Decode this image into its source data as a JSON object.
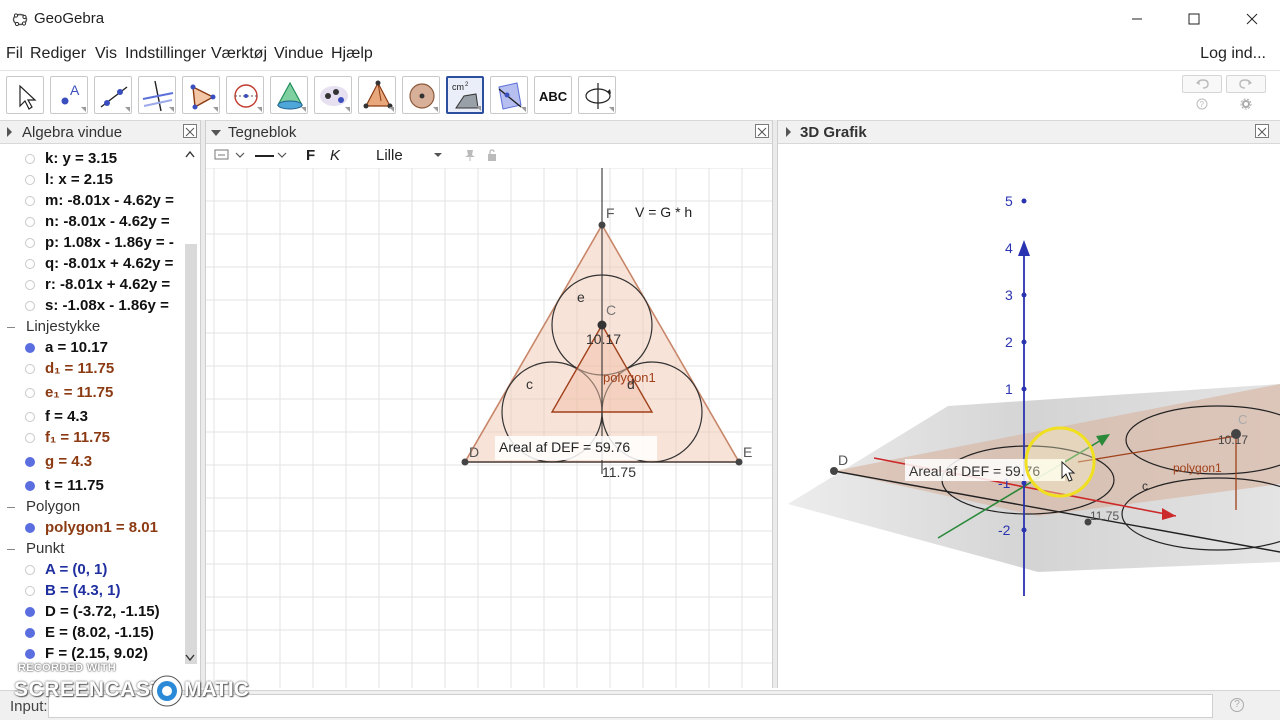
{
  "window": {
    "title": "GeoGebra"
  },
  "menu": {
    "items": [
      "Fil",
      "Rediger",
      "Vis",
      "Indstillinger",
      "Værktøj",
      "Vindue",
      "Hjælp"
    ],
    "login": "Log ind..."
  },
  "toolbar": {
    "tools": [
      {
        "icon": "move-arrow-icon"
      },
      {
        "icon": "point-icon",
        "label": "A"
      },
      {
        "icon": "line-icon"
      },
      {
        "icon": "perpendicular-line-icon"
      },
      {
        "icon": "polygon-icon"
      },
      {
        "icon": "circle-icon"
      },
      {
        "icon": "cone-icon"
      },
      {
        "icon": "reflect-icon"
      },
      {
        "icon": "pyramid-icon"
      },
      {
        "icon": "sphere-icon"
      },
      {
        "icon": "area-measure-icon",
        "label": "cm²"
      },
      {
        "icon": "plane-icon"
      },
      {
        "icon": "text-icon",
        "label": "ABC"
      },
      {
        "icon": "rotate-view-icon"
      }
    ]
  },
  "algebra": {
    "title": "Algebra vindue",
    "rows": [
      {
        "type": "item",
        "text": "k: y = 3.15",
        "color": "#111111",
        "dot": "empty"
      },
      {
        "type": "item",
        "text": "l: x = 2.15",
        "color": "#111111",
        "dot": "empty"
      },
      {
        "type": "item",
        "text": "m: -8.01x - 4.62y =",
        "color": "#111111",
        "dot": "empty"
      },
      {
        "type": "item",
        "text": "n: -8.01x - 4.62y =",
        "color": "#111111",
        "dot": "empty"
      },
      {
        "type": "item",
        "text": "p: 1.08x - 1.86y = -",
        "color": "#111111",
        "dot": "empty"
      },
      {
        "type": "item",
        "text": "q: -8.01x + 4.62y =",
        "color": "#111111",
        "dot": "empty"
      },
      {
        "type": "item",
        "text": "r: -8.01x + 4.62y =",
        "color": "#111111",
        "dot": "empty"
      },
      {
        "type": "item",
        "text": "s: -1.08x - 1.86y =",
        "color": "#111111",
        "dot": "empty"
      },
      {
        "type": "category",
        "text": "Linjestykke"
      },
      {
        "type": "item",
        "text": "a = 10.17",
        "color": "#111111",
        "dot": "filled"
      },
      {
        "type": "item",
        "text": "d₁ = 11.75",
        "color": "#8b3a12",
        "dot": "empty"
      },
      {
        "type": "item",
        "text": "e₁ = 11.75",
        "color": "#8b3a12",
        "dot": "empty"
      },
      {
        "type": "item",
        "text": "f = 4.3",
        "color": "#111111",
        "dot": "empty"
      },
      {
        "type": "item",
        "text": "f₁ = 11.75",
        "color": "#8b3a12",
        "dot": "empty"
      },
      {
        "type": "item",
        "text": "g = 4.3",
        "color": "#8b3a12",
        "dot": "filled"
      },
      {
        "type": "item",
        "text": "t = 11.75",
        "color": "#111111",
        "dot": "filled"
      },
      {
        "type": "category",
        "text": "Polygon"
      },
      {
        "type": "item",
        "text": "polygon1 = 8.01",
        "color": "#8b3a12",
        "dot": "filled"
      },
      {
        "type": "category",
        "text": "Punkt"
      },
      {
        "type": "item",
        "text": "A = (0, 1)",
        "color": "#1f2fa0",
        "dot": "empty"
      },
      {
        "type": "item",
        "text": "B = (4.3, 1)",
        "color": "#1f2fa0",
        "dot": "empty"
      },
      {
        "type": "item",
        "text": "D = (-3.72, -1.15)",
        "color": "#111111",
        "dot": "filled"
      },
      {
        "type": "item",
        "text": "E = (8.02, -1.15)",
        "color": "#111111",
        "dot": "filled"
      },
      {
        "type": "item",
        "text": "F = (2.15, 9.02)",
        "color": "#111111",
        "dot": "filled"
      }
    ]
  },
  "graphics": {
    "title": "Tegneblok",
    "style_bar": {
      "bold": "F",
      "italic": "K",
      "size": "Lille"
    },
    "labels": {
      "F": "F",
      "formula": "V = G * h",
      "C": "C",
      "e": "e",
      "a_value": "10.17",
      "polygon": "polygon1",
      "c": "c",
      "d": "d",
      "D": "D",
      "E": "E",
      "area_text": "Areal af  DEF = 59.76",
      "t_value": "11.75"
    }
  },
  "view3d": {
    "title": "3D Grafik",
    "z_ticks": [
      "5",
      "4",
      "3",
      "2",
      "1",
      "-1",
      "-2"
    ],
    "labels": {
      "D": "D",
      "C": "C",
      "area_text": "Areal af  DEF = 59.76",
      "polygon": "polygon1",
      "t_value": "11.75",
      "a_value": "10.17",
      "c": "c"
    }
  },
  "input": {
    "label": "Input:",
    "value": "",
    "help": "?"
  },
  "watermark": {
    "recorded": "RECORDED WITH",
    "brand_left": "SCREENCAST",
    "brand_right": "MATIC"
  }
}
